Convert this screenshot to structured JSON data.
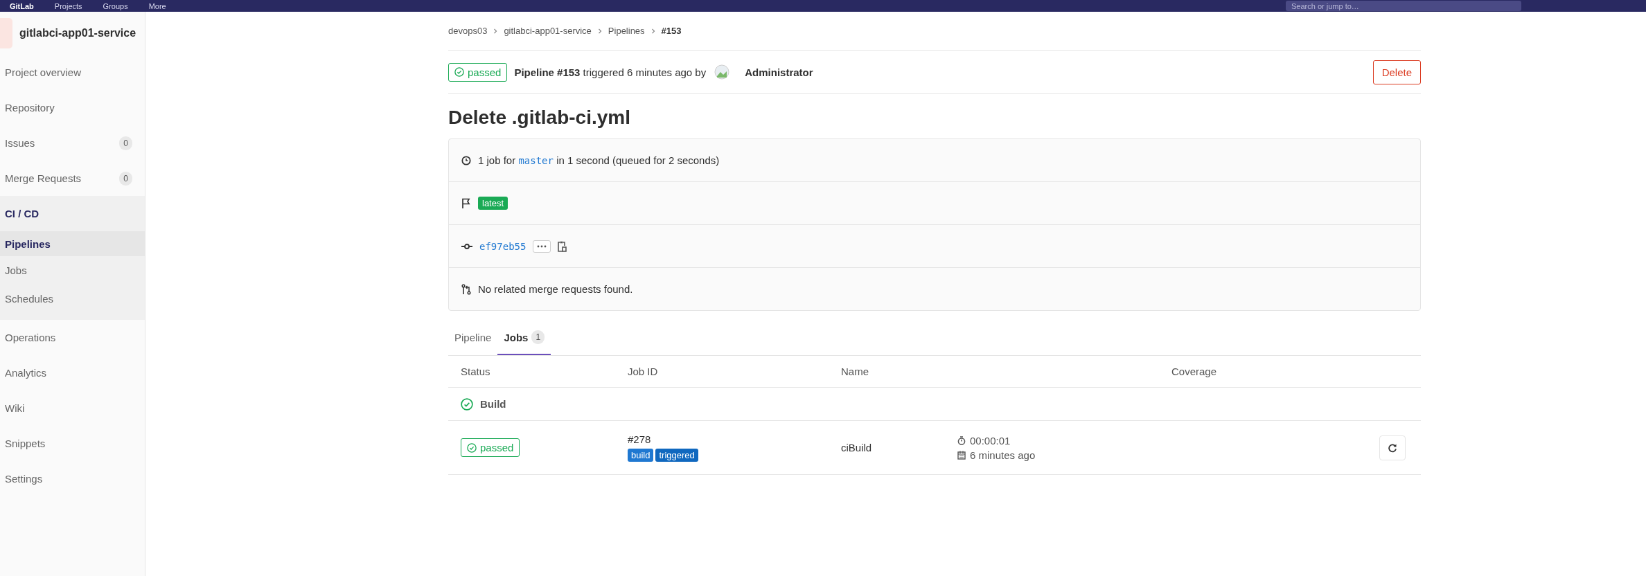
{
  "top_bar": {
    "logo": "GitLab",
    "menu": [
      "Projects",
      "Groups",
      "More"
    ],
    "search": {
      "placeholder": "Search or jump to…"
    }
  },
  "sidebar": {
    "project": "gitlabci-app01-service",
    "items": [
      {
        "label": "Project overview",
        "selected": false
      },
      {
        "label": "Repository",
        "selected": false
      },
      {
        "label": "Issues",
        "count": "0",
        "selected": false
      },
      {
        "label": "Merge Requests",
        "count": "0",
        "selected": false
      },
      {
        "label": "CI / CD",
        "selected": true,
        "children": [
          {
            "label": "Pipelines",
            "selected": true
          },
          {
            "label": "Jobs",
            "selected": false
          },
          {
            "label": "Schedules",
            "selected": false
          }
        ]
      },
      {
        "label": "Operations",
        "selected": false
      },
      {
        "label": "Analytics",
        "selected": false
      },
      {
        "label": "Wiki",
        "selected": false
      },
      {
        "label": "Snippets",
        "selected": false
      },
      {
        "label": "Settings",
        "selected": false
      }
    ]
  },
  "breadcrumbs": [
    "devops03",
    "gitlabci-app01-service",
    "Pipelines",
    "#153"
  ],
  "header": {
    "status": "passed",
    "summary": "**Pipeline #153** triggered 6 minutes ago by",
    "user": "Administrator",
    "delete_button": "Delete"
  },
  "title": "Delete .gitlab-ci.yml",
  "info_rows": [
    {
      "kind": "summary",
      "before": "1 job for",
      "branch": "master",
      "after": "in 1 second (queued for 2 seconds)"
    },
    {
      "kind": "tags",
      "badge": "latest"
    },
    {
      "kind": "commit",
      "sha": "ef97eb55"
    },
    {
      "kind": "merge",
      "text": "No related merge requests found."
    }
  ],
  "tabs": [
    {
      "label": "Pipeline",
      "selected": false
    },
    {
      "label": "Jobs",
      "count": "1",
      "selected": true
    }
  ],
  "table": {
    "columns": [
      "Status",
      "Job ID",
      "Name",
      "Coverage"
    ],
    "stages": [
      {
        "name": "Build",
        "jobs": [
          {
            "status": "passed",
            "id": "#278",
            "tags": [
              "build",
              "triggered"
            ],
            "name": "ciBuild",
            "duration": "00:00:01",
            "finished": "6 minutes ago"
          }
        ]
      }
    ]
  }
}
